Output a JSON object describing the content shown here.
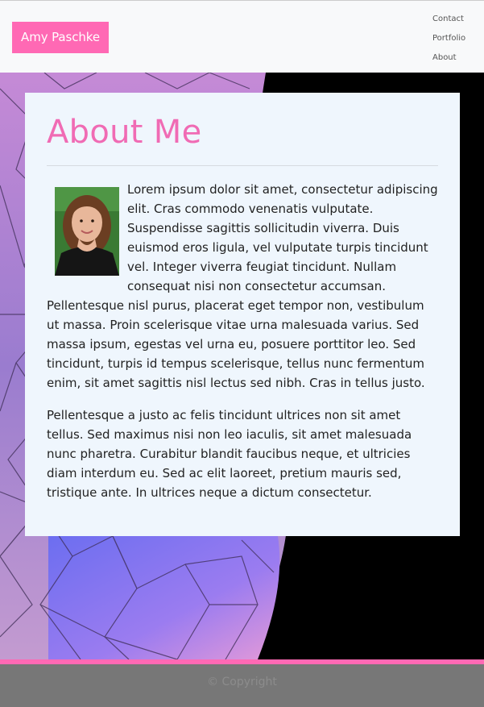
{
  "header": {
    "brand": "Amy Paschke",
    "nav": [
      "Contact",
      "Portfolio",
      "About"
    ]
  },
  "main": {
    "title": "About Me",
    "paragraphs": [
      "Lorem ipsum dolor sit amet, consectetur adipiscing elit. Cras commodo venenatis vulputate. Suspendisse sagittis sollicitudin viverra. Duis euismod eros ligula, vel vulputate turpis tincidunt vel. Integer viverra feugiat tincidunt. Nullam consequat nisi non consectetur accumsan. Pellentesque nisl purus, placerat eget tempor non, vestibulum ut massa. Proin scelerisque vitae urna malesuada varius. Sed massa ipsum, egestas vel urna eu, posuere porttitor leo. Sed tincidunt, turpis id tempus scelerisque, tellus nunc fermentum enim, sit amet sagittis nisl lectus sed nibh. Cras in tellus justo.",
      "Pellentesque a justo ac felis tincidunt ultrices non sit amet tellus. Sed maximus nisi non leo iaculis, sit amet malesuada nunc pharetra. Curabitur blandit faucibus neque, et ultricies diam interdum eu. Sed ac elit laoreet, pretium mauris sed, tristique ante. In ultrices neque a dictum consectetur."
    ]
  },
  "footer": {
    "copyright": "© Copyright"
  },
  "colors": {
    "accent": "#ff69b4",
    "title": "#f06bb4",
    "card_bg": "#eff6fd",
    "header_bg": "#f8f9fa",
    "footer_bg": "#777777"
  }
}
